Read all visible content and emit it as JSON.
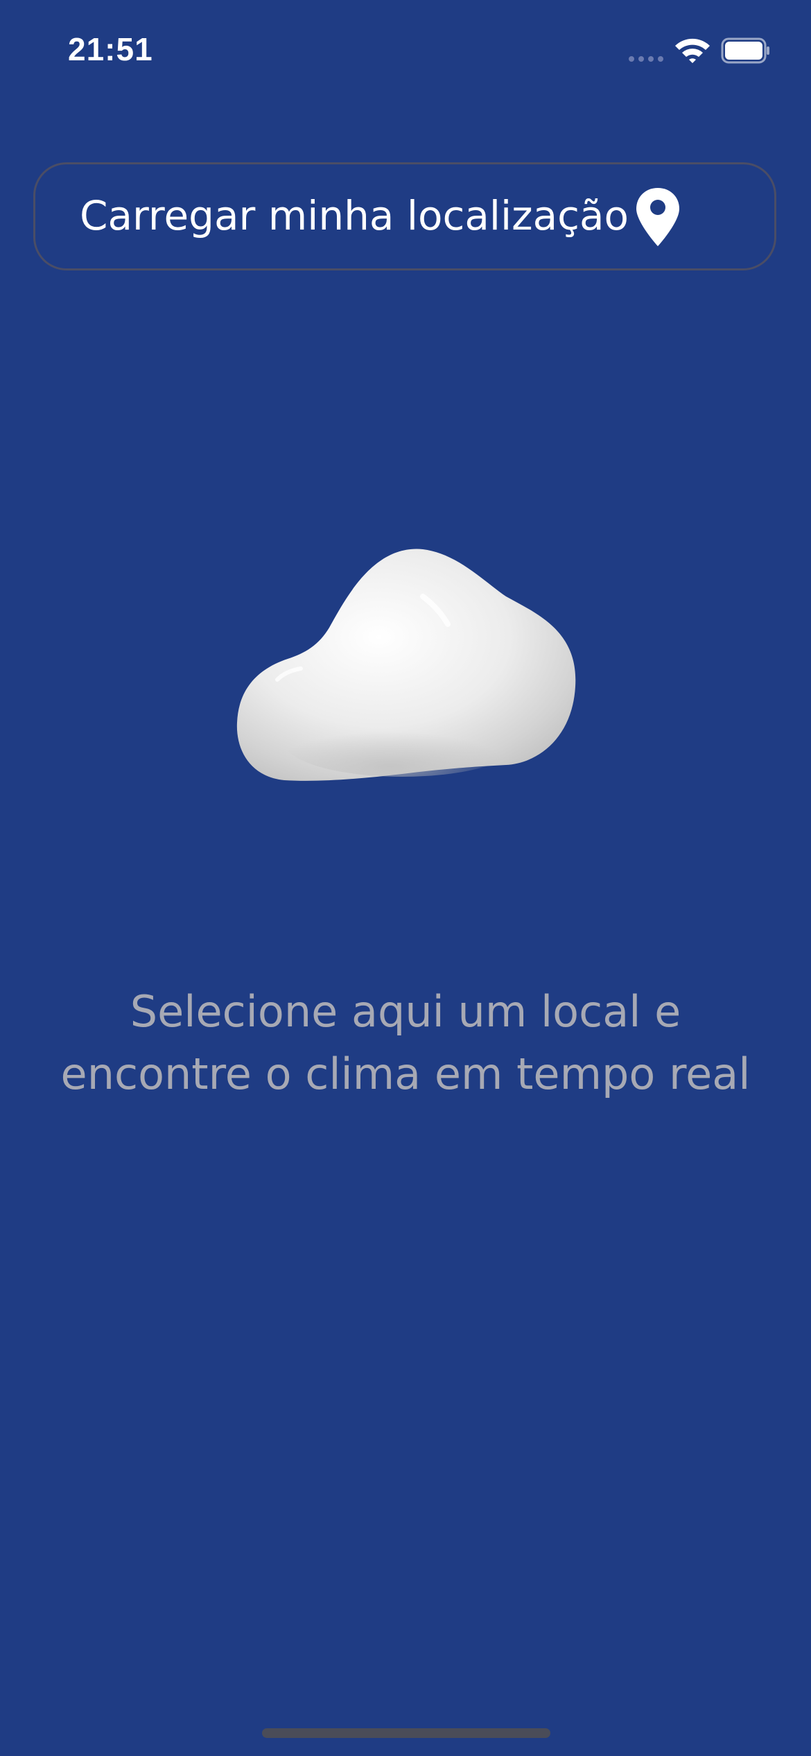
{
  "status_bar": {
    "time": "21:51",
    "icons": [
      "signal-dots-icon",
      "wifi-icon",
      "battery-icon"
    ]
  },
  "location_button": {
    "label": "Carregar minha localização",
    "icon": "map-pin-icon"
  },
  "illustration": {
    "icon": "cloud-icon"
  },
  "tagline": {
    "line1": "Selecione aqui um local e",
    "line2": "encontre o clima em tempo real"
  },
  "colors": {
    "background": "#1f3c84",
    "button_border": "#4a4d66",
    "text_primary": "#ffffff",
    "text_secondary": "#a7a9b4"
  }
}
